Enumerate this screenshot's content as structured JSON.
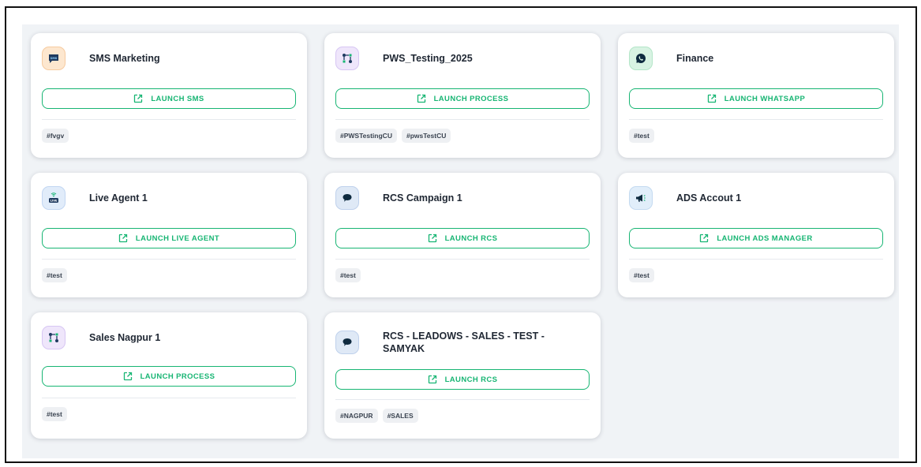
{
  "launch_prefix": "",
  "cards": [
    {
      "title": "SMS Marketing",
      "button": "LAUNCH SMS",
      "icon": "sms-icon",
      "tags": [
        "#fvgv"
      ]
    },
    {
      "title": "PWS_Testing_2025",
      "button": "LAUNCH PROCESS",
      "icon": "process-flow-icon",
      "tags": [
        "#PWSTestingCU",
        "#pwsTestCU"
      ]
    },
    {
      "title": "Finance",
      "button": "LAUNCH WHATSAPP",
      "icon": "whatsapp-icon",
      "tags": [
        "#test"
      ]
    },
    {
      "title": "Live Agent 1",
      "button": "LAUNCH LIVE AGENT",
      "icon": "live-agent-icon",
      "tags": [
        "#test"
      ]
    },
    {
      "title": "RCS Campaign 1",
      "button": "LAUNCH RCS",
      "icon": "chat-bubble-icon",
      "tags": [
        "#test"
      ]
    },
    {
      "title": "ADS Accout 1",
      "button": "LAUNCH ADS MANAGER",
      "icon": "megaphone-icon",
      "tags": [
        "#test"
      ]
    },
    {
      "title": "Sales Nagpur 1",
      "button": "LAUNCH PROCESS",
      "icon": "process-flow-icon",
      "tags": [
        "#test"
      ]
    },
    {
      "title": "RCS - LEADOWS - SALES - TEST - SAMYAK",
      "button": "LAUNCH RCS",
      "icon": "chat-bubble-icon",
      "tags": [
        "#NAGPUR",
        "#SALES"
      ]
    }
  ],
  "colors": {
    "accent": "#17b573",
    "background": "#f0f3f6",
    "card": "#ffffff",
    "tag_bg": "#eef0f3",
    "title_text": "#1f2733"
  }
}
